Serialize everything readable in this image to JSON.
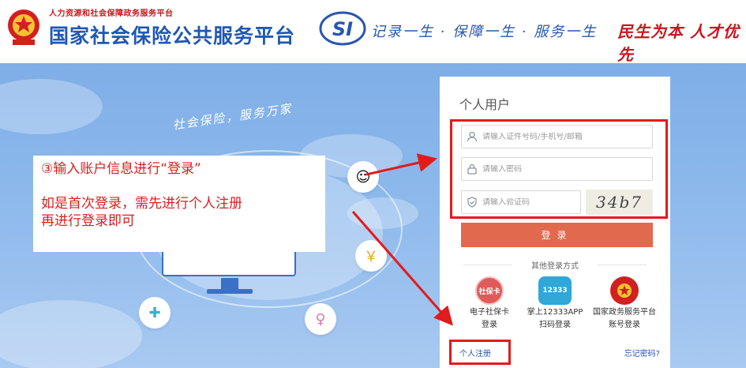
{
  "header": {
    "org_small": "人力资源和社会保障政务服务平台",
    "org_big": "国家社会保险公共服务平台",
    "si_logo_text": "SI",
    "slogan": "记录一生 · 保障一生 · 服务一生",
    "motto": "民生为本 人才优先"
  },
  "hero": {
    "slogan": "社会保险，服务万家"
  },
  "annotation": {
    "line1": "③输入账户信息进行“登录”",
    "line2": "如是首次登录，需先进行个人注册",
    "line3": "再进行登录即可"
  },
  "login": {
    "title": "个人用户",
    "id_placeholder": "请输入证件号码/手机号/邮箱",
    "password_placeholder": "请输入密码",
    "captcha_placeholder": "请输入验证码",
    "captcha_text": "34b7",
    "login_button": "登录",
    "other_methods": "其他登录方式",
    "alt_methods": [
      {
        "line1": "电子社保卡",
        "line2": "登录",
        "badge": "社保卡"
      },
      {
        "line1": "掌上12333APP",
        "line2": "扫码登录",
        "badge": "12333"
      },
      {
        "line1": "国家政务服务平台",
        "line2": "账号登录",
        "badge": ""
      }
    ],
    "register": "个人注册",
    "forgot": "忘记密码?"
  },
  "colors": {
    "brand_blue": "#1f58b4",
    "brand_red": "#c8161d",
    "login_button": "#e1694e",
    "highlight": "#e21b1b"
  }
}
